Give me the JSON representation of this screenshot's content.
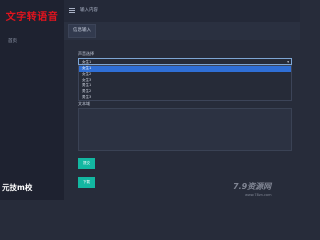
{
  "sidebar": {
    "brand_title": "文字转语音",
    "nav_home": "首页",
    "footer_brand": "元技m校"
  },
  "topbar": {
    "menu_icon": "menu-icon",
    "page_title": "输入内容"
  },
  "tabs": {
    "active": "信息输入"
  },
  "form": {
    "voice_label": "声音选择",
    "voice_selected": "女生1",
    "voice_options": [
      "女生1",
      "女生2",
      "女生3",
      "男生1",
      "男生2",
      "男生3"
    ],
    "text_label": "文本域",
    "text_value": "",
    "submit_label": "提交",
    "download_label": "下载"
  },
  "watermark": {
    "text": "7.9资源网",
    "url": "www.78zn.com"
  },
  "colors": {
    "sidebar_bg": "#1e2230",
    "main_bg": "#272c3a",
    "brand_red": "#e0141e",
    "accent_teal": "#13b7a1",
    "selected_blue": "#2f6fd6"
  }
}
